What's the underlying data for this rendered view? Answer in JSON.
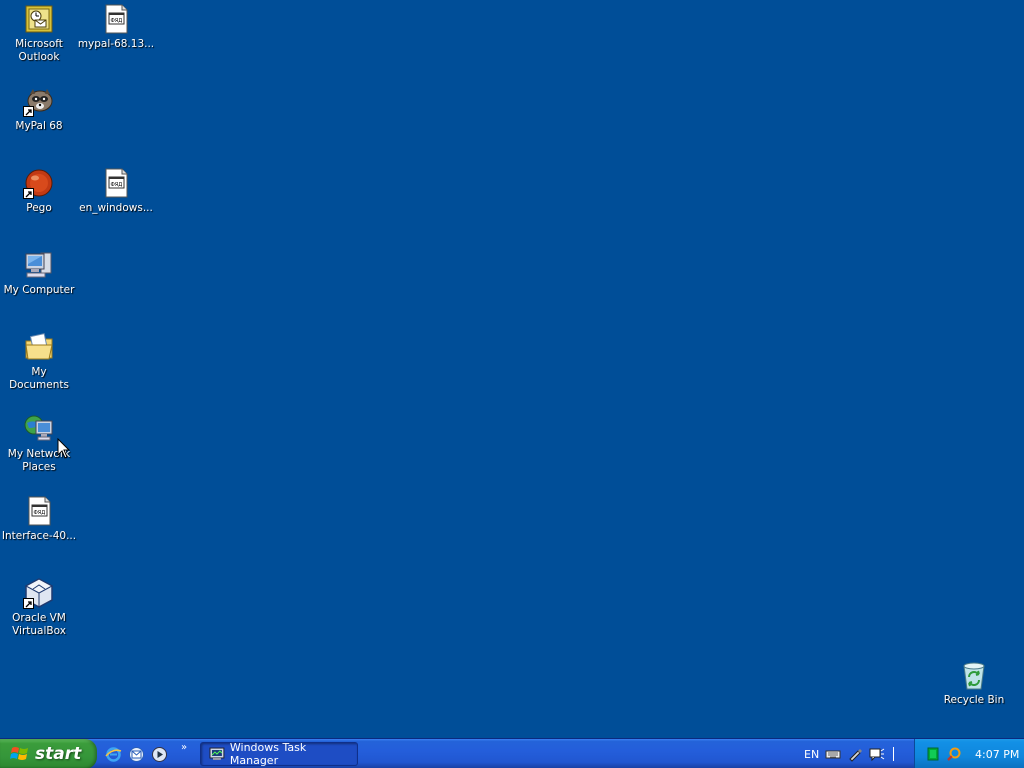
{
  "desktop": {
    "icons": [
      {
        "label": "Microsoft Outlook",
        "icon": "outlook-icon"
      },
      {
        "label": "mypal-68.13...",
        "icon": "document-icon"
      },
      {
        "label": "MyPal 68",
        "icon": "mypal-icon"
      },
      {
        "label": "Pego",
        "icon": "pego-icon"
      },
      {
        "label": "en_windows...",
        "icon": "document-icon"
      },
      {
        "label": "My Computer",
        "icon": "computer-icon"
      },
      {
        "label": "My Documents",
        "icon": "documents-folder-icon"
      },
      {
        "label": "My Network Places",
        "icon": "network-icon"
      },
      {
        "label": "Interface-40...",
        "icon": "document-icon"
      },
      {
        "label": "Oracle VM VirtualBox",
        "icon": "virtualbox-icon"
      },
      {
        "label": "Recycle Bin",
        "icon": "recycle-bin-icon"
      }
    ]
  },
  "taskbar": {
    "start_label": "start",
    "quicklaunch": [
      "internet-explorer-icon",
      "outlook-express-icon",
      "media-player-icon"
    ],
    "chevron": "»",
    "task_button": "Windows Task Manager",
    "language": "EN",
    "clock": "4:07 PM"
  },
  "colors": {
    "desktop": "#004e98",
    "taskbar": "#245edb",
    "start": "#35963a",
    "systray": "#0f86dc"
  }
}
